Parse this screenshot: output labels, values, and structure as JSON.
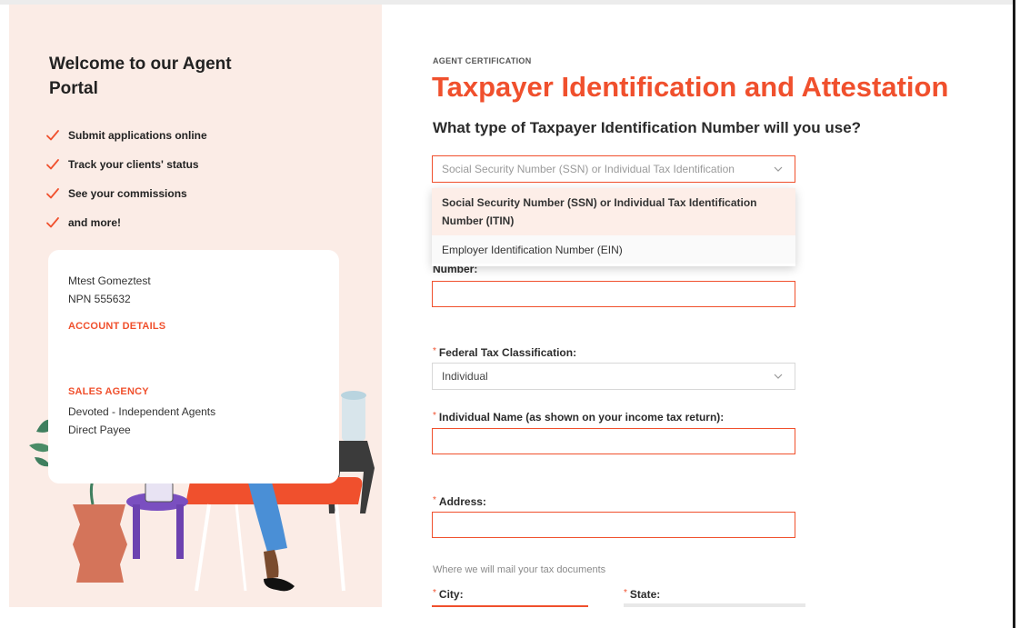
{
  "sidebar": {
    "welcome_title": "Welcome to our Agent Portal",
    "benefits": [
      "Submit applications online",
      "Track your clients' status",
      "See your commissions",
      "and more!"
    ],
    "check_icon": "checkmark-icon",
    "account": {
      "name": "Mtest Gomeztest",
      "npn": "NPN 555632",
      "details_link": "ACCOUNT DETAILS",
      "sales_agency_label": "SALES AGENCY",
      "agency_name": "Devoted - Independent Agents",
      "payee_type": "Direct Payee"
    }
  },
  "main": {
    "eyebrow": "AGENT CERTIFICATION",
    "title": "Taxpayer Identification and Attestation",
    "question": "What type of Taxpayer Identification Number will you use?",
    "tin_select": {
      "value": "Social Security Number (SSN) or Individual Tax Identification",
      "options": [
        "Social Security Number (SSN) or Individual Tax Identification Number (ITIN)",
        "Employer Identification Number (EIN)"
      ]
    },
    "number_label": "Number:",
    "number_value": "",
    "federal_tax": {
      "label": "Federal Tax Classification:",
      "value": "Individual"
    },
    "individual_name_label": "Individual Name (as shown on your income tax return):",
    "address_label": "Address:",
    "address_hint": "Where we will mail your tax documents",
    "city_label": "City:",
    "state_label": "State:",
    "required_marker": "*"
  },
  "colors": {
    "accent": "#f0502d",
    "panel_bg": "#fbece6",
    "selected_option_bg": "#fdeee8"
  }
}
